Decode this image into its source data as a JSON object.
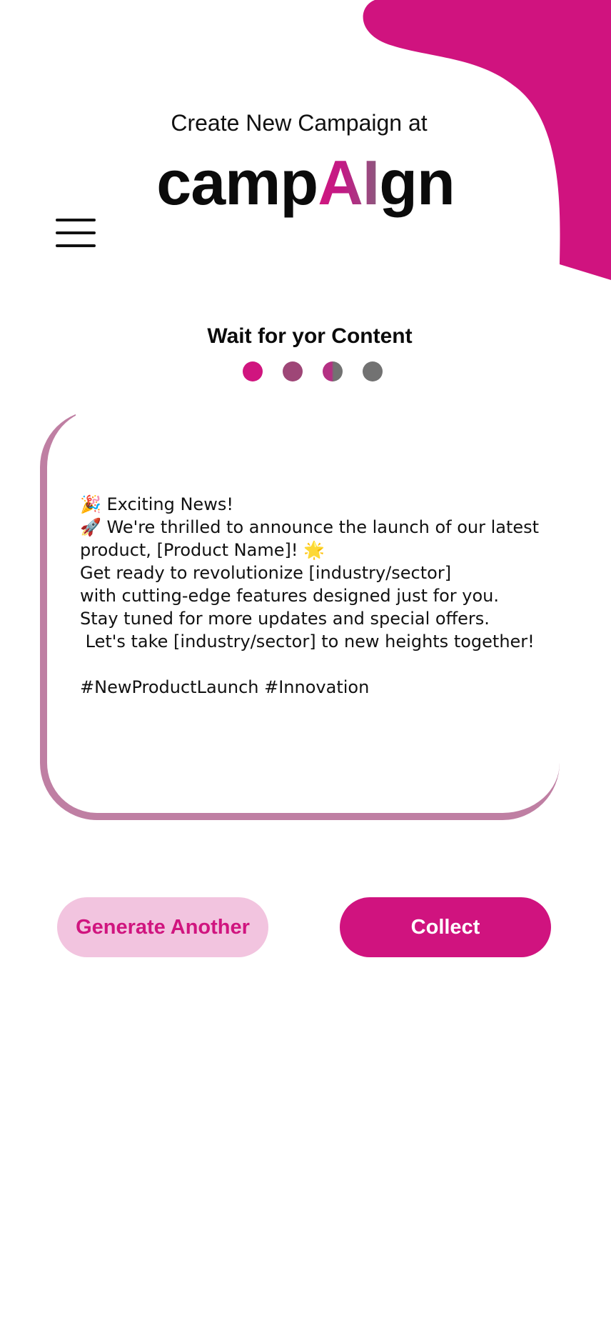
{
  "header": {
    "subtitle": "Create New Campaign at",
    "logo": {
      "part1": "camp",
      "part2": "AI",
      "part3": "gn"
    }
  },
  "menu": {
    "icon": "hamburger-menu-icon"
  },
  "status": {
    "title": "Wait for yor Content",
    "progress_dots": [
      {
        "color": "#d0157f"
      },
      {
        "color": "#9e4677"
      },
      {
        "color_left": "#b43083",
        "color_right": "#727272"
      },
      {
        "color": "#727272"
      }
    ]
  },
  "content": {
    "post_text": "🎉 Exciting News!\n🚀 We're thrilled to announce the launch of our latest product, [Product Name]! 🌟\nGet ready to revolutionize [industry/sector]\nwith cutting-edge features designed just for you.\nStay tuned for more updates and special offers.\n Let's take [industry/sector] to new heights together!\n\n#NewProductLaunch #Innovation"
  },
  "actions": {
    "generate_label": "Generate Another",
    "collect_label": "Collect"
  },
  "colors": {
    "brand": "#d0137f",
    "brand_light": "#f2c4df",
    "card_border": "#bf7fa3"
  }
}
